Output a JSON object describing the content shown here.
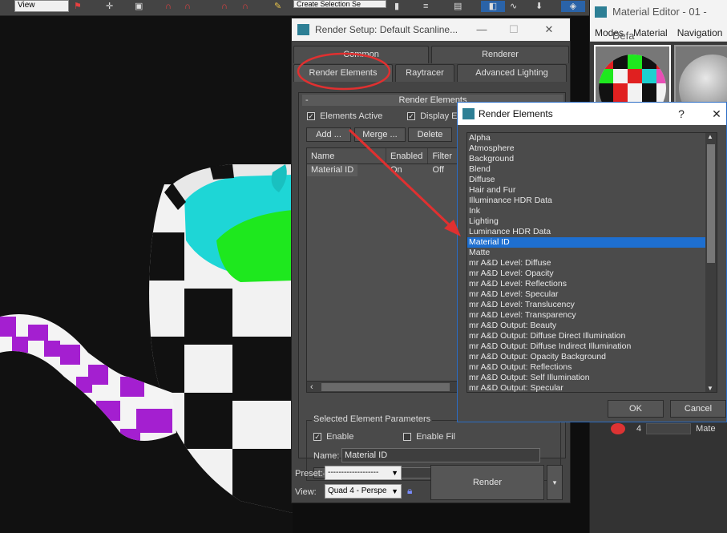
{
  "toolbar": {
    "view_select": "View",
    "selection_set": "Create Selection Se"
  },
  "render_setup": {
    "title": "Render Setup: Default Scanline...",
    "window_buttons": {
      "minimize": "—",
      "maximize": "☐",
      "close": "✕"
    },
    "tabs_row1": [
      "Common",
      "Renderer"
    ],
    "tabs_row2": [
      "Render Elements",
      "Raytracer",
      "Advanced Lighting"
    ],
    "rollout_title": "Render Elements",
    "rollout_toggle": "-",
    "elements_active_label": "Elements Active",
    "display_elements_label": "Display El",
    "buttons": {
      "add": "Add ...",
      "merge": "Merge ...",
      "delete": "Delete"
    },
    "table": {
      "headers": [
        "Name",
        "Enabled",
        "Filter"
      ],
      "rows": [
        {
          "name": "Material ID",
          "enabled": "On",
          "filter": "Off"
        }
      ]
    },
    "selected_params": {
      "legend": "Selected Element Parameters",
      "enable_label": "Enable",
      "enable_filter_label": "Enable Fil",
      "name_label": "Name:",
      "name_value": "Material ID",
      "browse_button": "..."
    },
    "preset_label": "Preset:",
    "preset_value": "-------------------",
    "view_label": "View:",
    "view_value": "Quad 4 - Perspe",
    "render_button": "Render",
    "render_dropdown": "▾"
  },
  "material_editor": {
    "title": "Material Editor - 01 - Defa",
    "menu": [
      "Modes",
      "Material",
      "Navigation"
    ],
    "slot_number": "4",
    "material_label": "Mate"
  },
  "render_elements_dialog": {
    "title": "Render Elements",
    "help": "?",
    "close": "✕",
    "items": [
      "Alpha",
      "Atmosphere",
      "Background",
      "Blend",
      "Diffuse",
      "Hair and Fur",
      "Illuminance HDR Data",
      "Ink",
      "Lighting",
      "Luminance HDR Data",
      "Material ID",
      "Matte",
      "mr A&D Level: Diffuse",
      "mr A&D Level: Opacity",
      "mr A&D Level: Reflections",
      "mr A&D Level: Specular",
      "mr A&D Level: Translucency",
      "mr A&D Level: Transparency",
      "mr A&D Output: Beauty",
      "mr A&D Output: Diffuse Direct Illumination",
      "mr A&D Output: Diffuse Indirect Illumination",
      "mr A&D Output: Opacity Background",
      "mr A&D Output: Reflections",
      "mr A&D Output: Self Illumination",
      "mr A&D Output: Specular"
    ],
    "selected_item": "Material ID",
    "ok_button": "OK",
    "cancel_button": "Cancel"
  },
  "colors": {
    "selection": "#1e6fd0",
    "annotation_red": "#e03030",
    "panel": "#4a4a4a"
  }
}
